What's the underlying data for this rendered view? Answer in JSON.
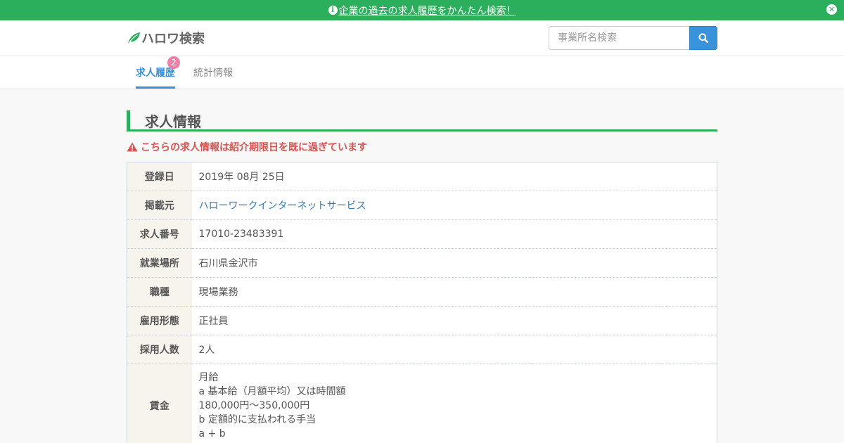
{
  "topbar": {
    "message": "企業の過去の求人履歴をかんたん検索！",
    "info_icon": "info-circle-icon",
    "close_icon": "times-circle-icon"
  },
  "header": {
    "brand": "ハロワ検索",
    "brand_icon": "leaf-icon",
    "search_placeholder": "事業所名検索",
    "search_icon": "search-icon"
  },
  "tabs": [
    {
      "label": "求人履歴",
      "badge": "2",
      "active": true
    },
    {
      "label": "統計情報",
      "active": false
    }
  ],
  "section": {
    "title": "求人情報",
    "warning": "こちらの求人情報は紹介期限日を既に過ぎています"
  },
  "details": [
    {
      "label": "登録日",
      "value": "2019年 08月 25日"
    },
    {
      "label": "掲載元",
      "value": "ハローワークインターネットサービス",
      "link": true
    },
    {
      "label": "求人番号",
      "value": "17010-23483391"
    },
    {
      "label": "就業場所",
      "value": "石川県金沢市"
    },
    {
      "label": "職種",
      "value": "現場業務"
    },
    {
      "label": "雇用形態",
      "value": "正社員"
    },
    {
      "label": "採用人数",
      "value": "2人"
    }
  ],
  "wage": {
    "label": "賃金",
    "lines": [
      "月給",
      "a 基本給（月額平均）又は時間額",
      "180,000円～350,000円",
      "b 定額的に支払われる手当",
      "a + b"
    ]
  },
  "colors": {
    "brand_green": "#2baf5d",
    "link_blue": "#337ab7",
    "tab_active": "#3a8fd9",
    "badge_pink": "#ef7fa5",
    "warning_red": "#d9534f"
  }
}
